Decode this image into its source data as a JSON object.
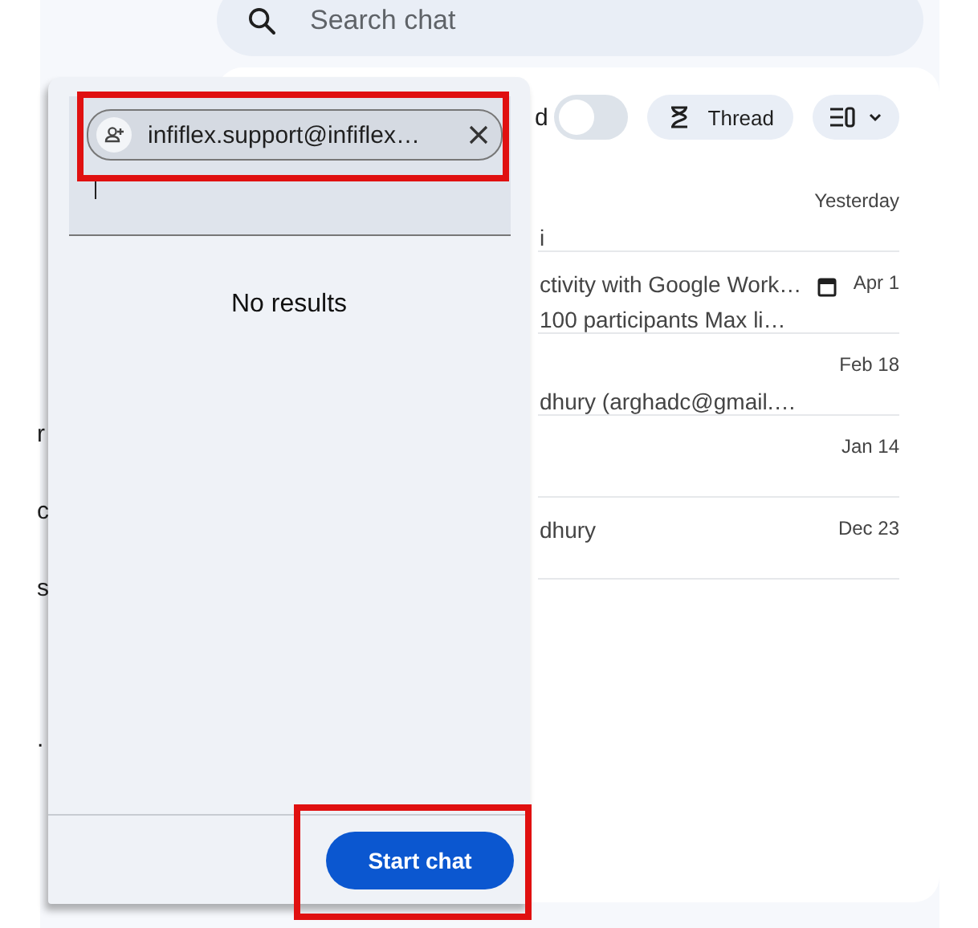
{
  "search": {
    "placeholder": "Search chat"
  },
  "sidebar": {
    "items": [
      {
        "label": "r"
      },
      {
        "label": "c"
      },
      {
        "label": "s"
      },
      {
        "label": "."
      }
    ]
  },
  "toolbar": {
    "toggle_label": "d",
    "toggle_on": false,
    "thread_button": "Thread"
  },
  "rows": [
    {
      "line_2": "i",
      "date": "Yesterday"
    },
    {
      "line_1": "ctivity with Google Work…",
      "line_2": "100 participants Max li…",
      "date": "Apr 1",
      "calendar": true
    },
    {
      "line_2": "dhury (arghadc@gmail.…",
      "date": "Feb 18"
    },
    {
      "date": "Jan 14"
    },
    {
      "line_1": "dhury",
      "date": "Dec 23"
    }
  ],
  "dialog": {
    "chip": {
      "text": "infiflex.support@infiflex…"
    },
    "message": "No results",
    "start_button": "Start chat"
  }
}
